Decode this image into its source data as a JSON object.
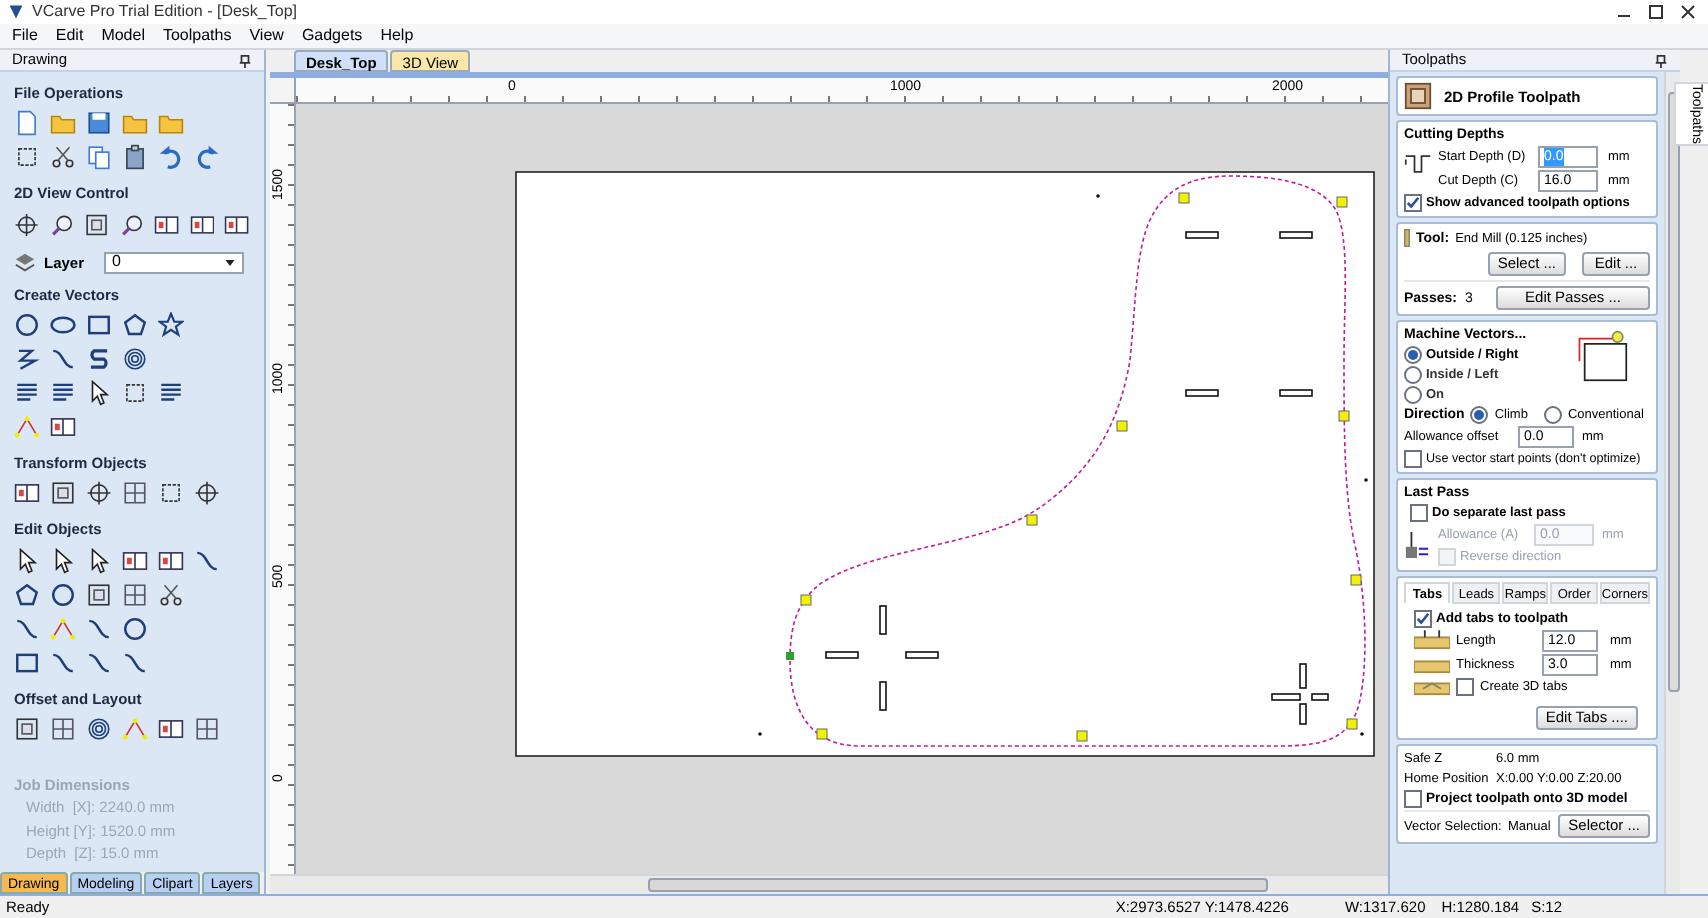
{
  "window": {
    "title": "VCarve Pro Trial Edition - [Desk_Top]"
  },
  "menu": [
    "File",
    "Edit",
    "Model",
    "Toolpaths",
    "View",
    "Gadgets",
    "Help"
  ],
  "left_panel": {
    "title": "Drawing",
    "sections": [
      {
        "title": "File Operations"
      },
      {
        "title": "2D View Control",
        "layer": {
          "label": "Layer",
          "value": "0"
        }
      },
      {
        "title": "Create Vectors"
      },
      {
        "title": "Transform Objects"
      },
      {
        "title": "Edit Objects"
      },
      {
        "title": "Offset and Layout"
      }
    ],
    "job_dimensions": {
      "title": "Job Dimensions",
      "rows": [
        "Width  [X]: 2240.0 mm",
        "Height [Y]: 1520.0 mm",
        "Depth  [Z]: 15.0 mm"
      ]
    },
    "bottom_tabs": [
      {
        "label": "Drawing",
        "selected": true
      },
      {
        "label": "Modeling",
        "selected": false
      },
      {
        "label": "Clipart",
        "selected": false
      },
      {
        "label": "Layers",
        "selected": false
      }
    ]
  },
  "document_tabs": [
    {
      "label": "Desk_Top",
      "selected": true
    },
    {
      "label": "3D View",
      "selected": false
    }
  ],
  "rulers": {
    "horizontal": [
      "0",
      "1000",
      "2000"
    ],
    "vertical": [
      "1500",
      "1000",
      "500",
      "0"
    ]
  },
  "right_panel": {
    "title": "Toolpaths",
    "toolpath_name": "2D Profile Toolpath",
    "cutting_depths": {
      "title": "Cutting Depths",
      "fields": [
        {
          "label": "Start Depth (D)",
          "value": "0.0",
          "unit": "mm",
          "selected": true
        },
        {
          "label": "Cut Depth (C)",
          "value": "16.0",
          "unit": "mm",
          "selected": false
        }
      ],
      "show_advanced": {
        "label": "Show advanced toolpath options",
        "checked": true
      }
    },
    "tool": {
      "label": "Tool:",
      "value": "End Mill (0.125 inches)",
      "buttons": [
        "Select ...",
        "Edit ..."
      ]
    },
    "passes": {
      "label": "Passes:",
      "value": "3",
      "button": "Edit Passes ..."
    },
    "machine_vectors": {
      "title": "Machine Vectors...",
      "options": [
        {
          "label": "Outside / Right",
          "selected": true
        },
        {
          "label": "Inside / Left",
          "selected": false
        },
        {
          "label": "On",
          "selected": false
        }
      ],
      "direction": {
        "label": "Direction",
        "options": [
          {
            "label": "Climb",
            "selected": true
          },
          {
            "label": "Conventional",
            "selected": false
          }
        ]
      },
      "allowance": {
        "label": "Allowance offset",
        "value": "0.0",
        "unit": "mm"
      },
      "use_start_points": {
        "label": "Use vector start points (don't optimize)",
        "checked": false
      }
    },
    "last_pass": {
      "title": "Last Pass",
      "separate": {
        "label": "Do separate last pass",
        "checked": false
      },
      "allowance": {
        "label": "Allowance (A)",
        "value": "0.0",
        "unit": "mm",
        "disabled": true
      },
      "reverse": {
        "label": "Reverse direction",
        "checked": false,
        "disabled": true
      }
    },
    "tabs": [
      {
        "label": "Tabs",
        "selected": true
      },
      {
        "label": "Leads",
        "selected": false
      },
      {
        "label": "Ramps",
        "selected": false
      },
      {
        "label": "Order",
        "selected": false
      },
      {
        "label": "Corners",
        "selected": false
      }
    ],
    "tabs_panel": {
      "add_tabs": {
        "label": "Add tabs to toolpath",
        "checked": true
      },
      "fields": [
        {
          "label": "Length",
          "value": "12.0",
          "unit": "mm"
        },
        {
          "label": "Thickness",
          "value": "3.0",
          "unit": "mm"
        }
      ],
      "create_3d": {
        "label": "Create 3D tabs",
        "checked": false
      },
      "button": "Edit Tabs ...."
    },
    "settings": {
      "safe_z": {
        "label": "Safe Z",
        "value": "6.0 mm"
      },
      "home": {
        "label": "Home Position",
        "value": "X:0.00 Y:0.00 Z:20.00"
      },
      "project": {
        "label": "Project toolpath onto 3D model",
        "checked": false
      },
      "vector_selection": {
        "label": "Vector Selection:",
        "value": "Manual",
        "button": "Selector ..."
      }
    }
  },
  "side_tab": "Toolpaths",
  "status_bar": {
    "message": "Ready",
    "cursor": "X:2973.6527 Y:1478.4226",
    "width": "W:1317.620",
    "height": "H:1280.184",
    "snap": "S:12"
  }
}
